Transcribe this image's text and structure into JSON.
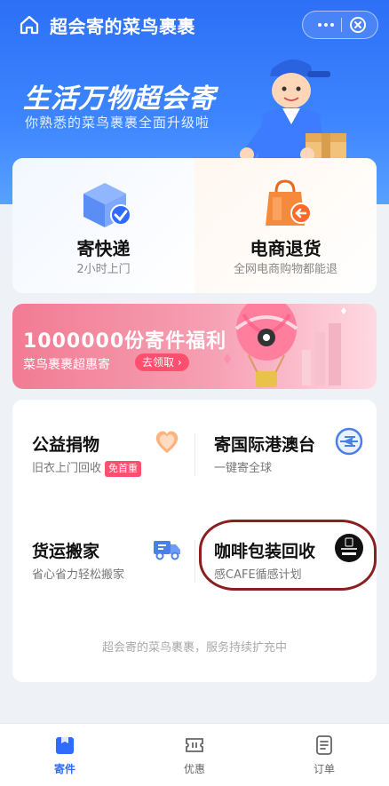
{
  "header": {
    "title": "超会寄的菜鸟裹裹",
    "home_icon": "home-icon",
    "more_icon": "more-dots-icon",
    "close_icon": "close-circle-icon"
  },
  "hero": {
    "slogan": "生活万物超会寄",
    "subtitle": "你熟悉的菜鸟裹裹全面升级啦"
  },
  "services": [
    {
      "title": "寄快递",
      "subtitle": "2小时上门",
      "icon": "package-check-icon"
    },
    {
      "title": "电商退货",
      "subtitle": "全网电商购物都能退",
      "icon": "shopping-bag-return-icon"
    }
  ],
  "banner": {
    "title": "1000000份寄件福利",
    "subtitle": "菜鸟裹裹超惠寄",
    "button": "去领取 ›"
  },
  "grid": {
    "items": [
      {
        "title": "公益捐物",
        "subtitle": "旧衣上门回收",
        "badge": "免首重",
        "icon": "heart-icon"
      },
      {
        "title": "寄国际港澳台",
        "subtitle": "一键寄全球",
        "icon": "airplane-globe-icon"
      },
      {
        "title": "货运搬家",
        "subtitle": "省心省力轻松搬家",
        "icon": "truck-icon"
      },
      {
        "title": "咖啡包装回收",
        "subtitle": "感CAFE循感计划",
        "icon": "nescafe-logo-icon"
      }
    ],
    "footer": "超会寄的菜鸟裹裹，服务持续扩充中"
  },
  "tabs": [
    {
      "label": "寄件",
      "icon": "send-package-icon",
      "active": true
    },
    {
      "label": "优惠",
      "icon": "coupon-icon",
      "active": false
    },
    {
      "label": "订单",
      "icon": "order-list-icon",
      "active": false
    }
  ],
  "colors": {
    "brand_blue": "#2d6ff6",
    "banner_pink": "#f27b93",
    "badge_red": "#ff4f6e",
    "tab_active": "#2f6bff"
  }
}
